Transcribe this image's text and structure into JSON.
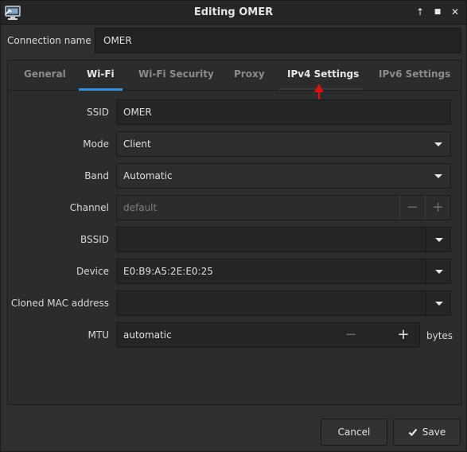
{
  "window": {
    "title": "Editing OMER"
  },
  "connection": {
    "label": "Connection name",
    "value": "OMER"
  },
  "tabs": [
    {
      "label": "General"
    },
    {
      "label": "Wi-Fi"
    },
    {
      "label": "Wi-Fi Security"
    },
    {
      "label": "Proxy"
    },
    {
      "label": "IPv4 Settings"
    },
    {
      "label": "IPv6 Settings"
    }
  ],
  "active_tab": "Wi-Fi",
  "wifi": {
    "ssid": {
      "label": "SSID",
      "value": "OMER"
    },
    "mode": {
      "label": "Mode",
      "value": "Client"
    },
    "band": {
      "label": "Band",
      "value": "Automatic"
    },
    "channel": {
      "label": "Channel",
      "value": "default"
    },
    "bssid": {
      "label": "BSSID",
      "value": ""
    },
    "device": {
      "label": "Device",
      "value": "E0:B9:A5:2E:E0:25"
    },
    "cloned_mac": {
      "label": "Cloned MAC address",
      "value": ""
    },
    "mtu": {
      "label": "MTU",
      "value": "automatic",
      "unit": "bytes"
    }
  },
  "buttons": {
    "cancel": "Cancel",
    "save": "Save"
  },
  "icons": {
    "minus": "−",
    "plus": "+",
    "maximize": "↑",
    "restore": "■",
    "close": "✕"
  },
  "colors": {
    "accent": "#3b8fd6",
    "annotation": "#e01010"
  }
}
